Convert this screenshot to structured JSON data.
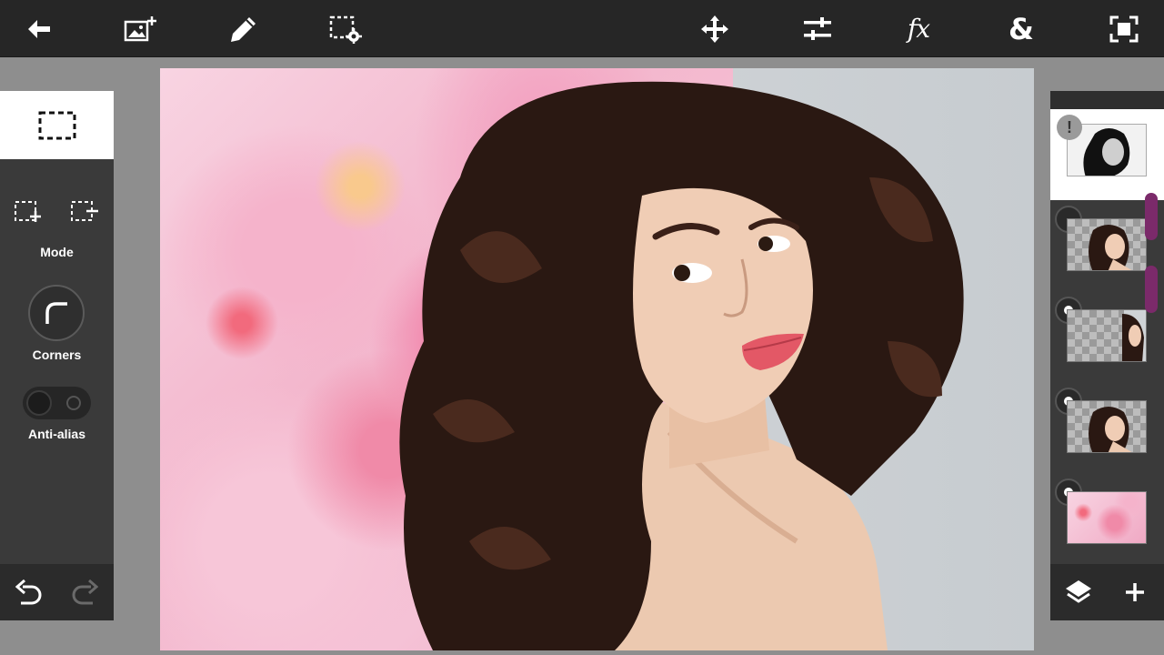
{
  "toolbar": {
    "items": [
      {
        "name": "back-arrow-icon"
      },
      {
        "name": "add-image-icon"
      },
      {
        "name": "brush-icon"
      },
      {
        "name": "selection-settings-icon"
      },
      {
        "name": "move-icon"
      },
      {
        "name": "adjustments-icon"
      },
      {
        "name": "fx-icon",
        "label": "fx"
      },
      {
        "name": "blend-icon",
        "label": "&"
      },
      {
        "name": "fit-screen-icon"
      }
    ]
  },
  "left_panel": {
    "active_tool": "rectangle-selection-icon",
    "mode_label": "Mode",
    "corners_label": "Corners",
    "antialias_label": "Anti-alias",
    "antialias_on": false
  },
  "layers": {
    "items": [
      {
        "name": "mask-layer",
        "active": true,
        "warning": "!"
      },
      {
        "name": "portrait-layer",
        "visible": false
      },
      {
        "name": "portrait-crop-layer",
        "visible": true
      },
      {
        "name": "portrait-copy-layer",
        "visible": true
      },
      {
        "name": "flowers-layer",
        "visible": true
      }
    ]
  },
  "colors": {
    "toolbar_bg": "#262626",
    "panel_bg": "#3a3a3a",
    "workspace_bg": "#8e8e8e",
    "scroll_accent": "#7b2a6a"
  }
}
